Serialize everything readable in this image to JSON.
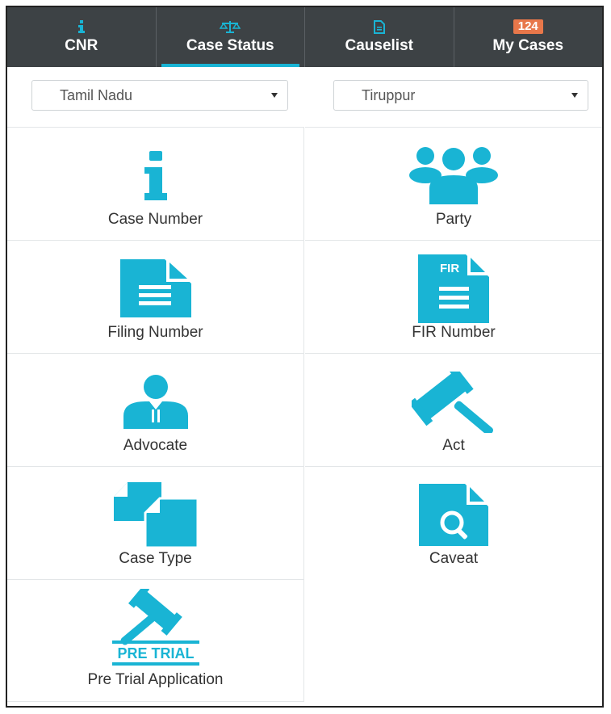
{
  "nav": {
    "tabs": [
      {
        "label": "CNR",
        "icon": "info-icon"
      },
      {
        "label": "Case Status",
        "icon": "scales-icon",
        "active": true
      },
      {
        "label": "Causelist",
        "icon": "document-icon"
      },
      {
        "label": "My Cases",
        "icon": "badge",
        "badge": "124"
      }
    ]
  },
  "filters": {
    "state": "Tamil Nadu",
    "district": "Tiruppur"
  },
  "options": [
    {
      "label": "Case Number",
      "icon": "info-icon"
    },
    {
      "label": "Party",
      "icon": "people-icon"
    },
    {
      "label": "Filing Number",
      "icon": "document-icon"
    },
    {
      "label": "FIR Number",
      "icon": "fir-document-icon"
    },
    {
      "label": "Advocate",
      "icon": "advocate-icon"
    },
    {
      "label": "Act",
      "icon": "gavel-icon"
    },
    {
      "label": "Case Type",
      "icon": "copy-documents-icon"
    },
    {
      "label": "Caveat",
      "icon": "search-document-icon"
    },
    {
      "label": "Pre Trial Application",
      "icon": "pre-trial-gavel-icon",
      "icon_text": "PRE TRIAL"
    }
  ],
  "colors": {
    "accent": "#19b4d4",
    "nav_bg": "#3d4245",
    "badge": "#e8774a"
  }
}
